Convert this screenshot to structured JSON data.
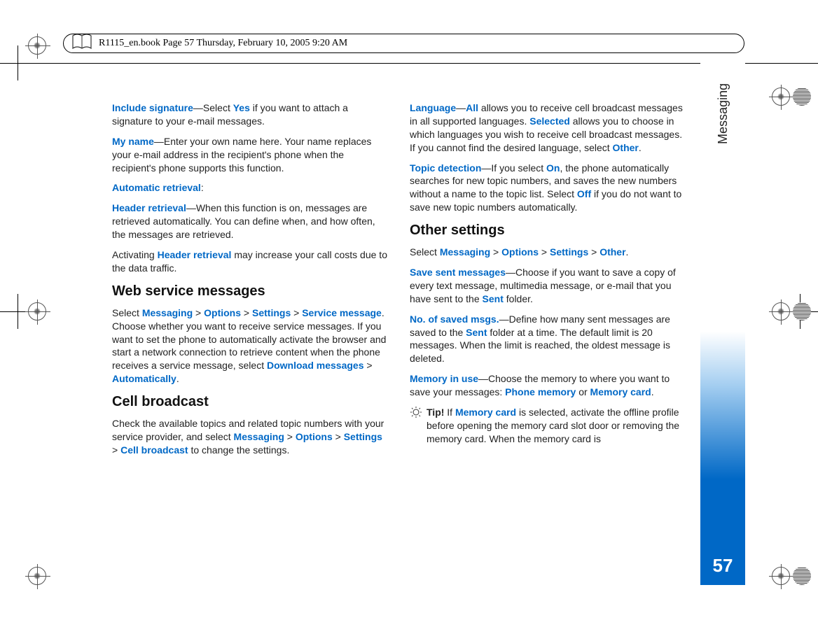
{
  "header": "R1115_en.book  Page 57  Thursday, February 10, 2005  9:20 AM",
  "sidebar": {
    "label": "Messaging",
    "page": "57"
  },
  "left": {
    "p1": {
      "a": "Include signature",
      "b": "—Select ",
      "c": "Yes",
      "d": " if you want to attach a signature to your e-mail messages."
    },
    "p2": {
      "a": "My name",
      "b": "—Enter your own name here. Your name replaces your e-mail address in the recipient's phone when the recipient's phone supports this function."
    },
    "p3": {
      "a": "Automatic retrieval",
      "b": ":"
    },
    "p4": {
      "a": "Header retrieval",
      "b": "—When this function is on, messages are retrieved automatically. You can define when, and how often, the messages are retrieved."
    },
    "p5": {
      "a": "Activating ",
      "b": "Header retrieval",
      "c": " may increase your call costs due to the data traffic."
    },
    "h1": "Web service messages",
    "p6": {
      "a": "Select ",
      "b": "Messaging",
      "c": " > ",
      "d": "Options",
      "e": " > ",
      "f": "Settings",
      "g": " > ",
      "h": "Service message",
      "i": ". Choose whether you want to receive service messages. If you want to set the phone to automatically activate the browser and start a network connection to retrieve content when the phone receives a service message, select ",
      "j": "Download messages",
      "k": " > ",
      "l": "Automatically",
      "m": "."
    },
    "h2": "Cell broadcast",
    "p7": {
      "a": "Check the available topics and related topic numbers with your service provider, and select ",
      "b": "Messaging",
      "c": " > ",
      "d": "Options",
      "e": " > ",
      "f": "Settings",
      "g": " > ",
      "h": "Cell broadcast",
      "i": " to change the settings."
    }
  },
  "right": {
    "p1": {
      "a": "Language",
      "b": "—",
      "c": "All",
      "d": " allows you to receive cell broadcast messages in all supported languages. ",
      "e": "Selected",
      "f": " allows you to choose in which languages you wish to receive cell broadcast messages. If you cannot find the desired language, select ",
      "g": "Other",
      "h": "."
    },
    "p2": {
      "a": "Topic detection",
      "b": "—If you select ",
      "c": "On",
      "d": ", the phone automatically searches for new topic numbers, and saves the new numbers without a name to the topic list. Select ",
      "e": "Off",
      "f": " if you do not want to save new topic numbers automatically."
    },
    "h1": "Other settings",
    "p3": {
      "a": "Select ",
      "b": "Messaging",
      "c": " > ",
      "d": "Options",
      "e": " > ",
      "f": "Settings",
      "g": " > ",
      "h": "Other",
      "i": "."
    },
    "p4": {
      "a": "Save sent messages",
      "b": "—Choose if you want to save a copy of every text message, multimedia message, or e-mail that you have sent to the ",
      "c": "Sent",
      "d": " folder."
    },
    "p5": {
      "a": "No. of saved msgs.",
      "b": "—Define how many sent messages are saved to the ",
      "c": "Sent",
      "d": " folder at a time. The default limit is 20 messages. When the limit is reached, the oldest message is deleted."
    },
    "p6": {
      "a": "Memory in use",
      "b": "—Choose the memory to where you want to save your messages: ",
      "c": "Phone memory",
      "d": " or ",
      "e": "Memory card",
      "f": "."
    },
    "tip": {
      "label": "Tip! ",
      "a": "If ",
      "b": "Memory card",
      "c": " is selected, activate the offline profile before opening the memory card slot door or removing the memory card. When the memory card is"
    }
  }
}
